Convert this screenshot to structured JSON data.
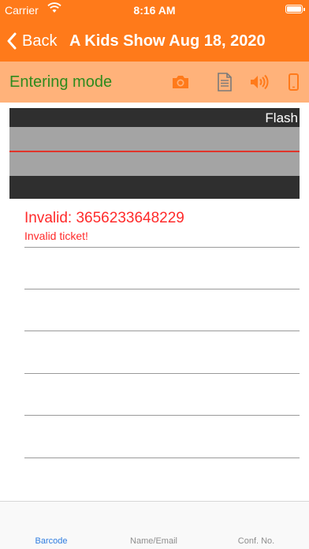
{
  "status": {
    "carrier": "Carrier",
    "time": "8:16 AM"
  },
  "nav": {
    "back_label": "Back",
    "title": "A Kids Show Aug 18, 2020"
  },
  "mode": {
    "label": "Entering mode",
    "tools": [
      "camera-icon",
      "document-icon",
      "speaker-icon",
      "phone-icon"
    ]
  },
  "scanner": {
    "flash_label": "Flash"
  },
  "result": {
    "title": "Invalid: 3656233648229",
    "message": "Invalid ticket!"
  },
  "tabs": [
    {
      "label": "Barcode",
      "active": true
    },
    {
      "label": "Name/Email",
      "active": false
    },
    {
      "label": "Conf. No.",
      "active": false
    }
  ],
  "colors": {
    "accent": "#ff7a1a",
    "mode_bar": "#ffb27a",
    "mode_text": "#2e8b1d",
    "error": "#ff2a2a",
    "tab_active": "#2f7de0"
  }
}
